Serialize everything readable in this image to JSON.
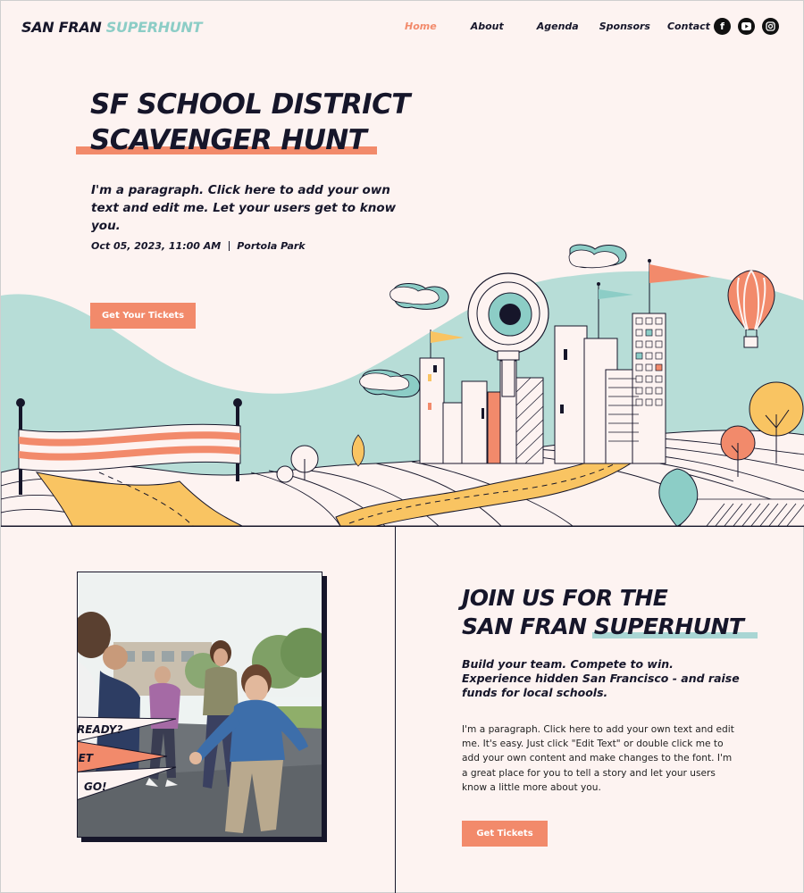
{
  "header": {
    "logo_part1": "SAN FRAN",
    "logo_part2": "SUPERHUNT",
    "nav": [
      "Home",
      "About",
      "Agenda",
      "Sponsors",
      "Contact"
    ],
    "active_nav": "Home",
    "social": [
      "facebook-icon",
      "youtube-icon",
      "instagram-icon"
    ]
  },
  "hero": {
    "title_line1": "SF SCHOOL DISTRICT",
    "title_line2": "SCAVENGER HUNT",
    "paragraph": "I'm a paragraph. Click here to add your own text and edit me. Let your users get to know you.",
    "date": "Oct 05, 2023, 11:00 AM",
    "location": "Portola Park",
    "button": "Get Your Tickets"
  },
  "photo_flags": [
    "READY?",
    "SET",
    "GO!"
  ],
  "join": {
    "title_line1": "JOIN US FOR THE",
    "title_line2a": "SAN FRAN",
    "title_line2b": "SUPERHUNT",
    "subtitle": "Build your team. Compete to win. Experience hidden San Francisco - and raise funds for local schools.",
    "paragraph": "I'm a paragraph. Click here to add your own text and edit me. It's easy. Just click \"Edit Text\" or double click me to add your own content and make changes to the font. I'm a great place for you to tell a story and let your users know a little more about you.",
    "button": "Get Tickets"
  },
  "colors": {
    "background": "#fdf3f1",
    "accent": "#f28a6b",
    "teal": "#8ccdc6",
    "dark": "#16162a",
    "yellow": "#f9c462"
  }
}
